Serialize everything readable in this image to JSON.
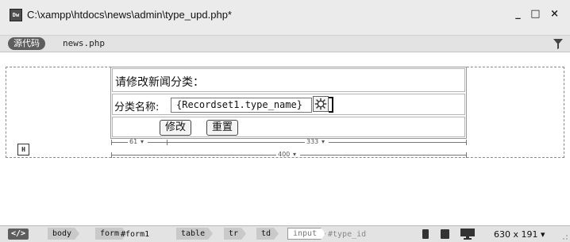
{
  "window": {
    "app_icon_text": "Dw",
    "title": "C:\\xampp\\htdocs\\news\\admin\\type_upd.php*",
    "controls": "_ □ ×"
  },
  "doc_tabs": {
    "source_label": "源代码",
    "file_name": "news.php"
  },
  "form": {
    "heading": "请修改新闻分类：",
    "field_label": "分类名称:",
    "field_value": "{Recordset1.type_name}",
    "submit_label": "修改",
    "reset_label": "重置"
  },
  "rulers": {
    "left_col": "61",
    "right_col": "333",
    "total": "400"
  },
  "marker_icon_text": "H",
  "status_bar": {
    "code_icon_text": "</>",
    "breadcrumb": [
      "body",
      "form",
      "#form1",
      "table",
      "tr",
      "td"
    ],
    "input_tag": "input",
    "input_id": "#type_id",
    "window_size": "630 x 191"
  },
  "icons": [
    "app-icon",
    "filter-icon",
    "gear-icon",
    "marker-icon",
    "code-icon",
    "phone-icon",
    "tablet-icon",
    "desktop-icon",
    "chevron-down-icon",
    "resize-grip-icon"
  ]
}
